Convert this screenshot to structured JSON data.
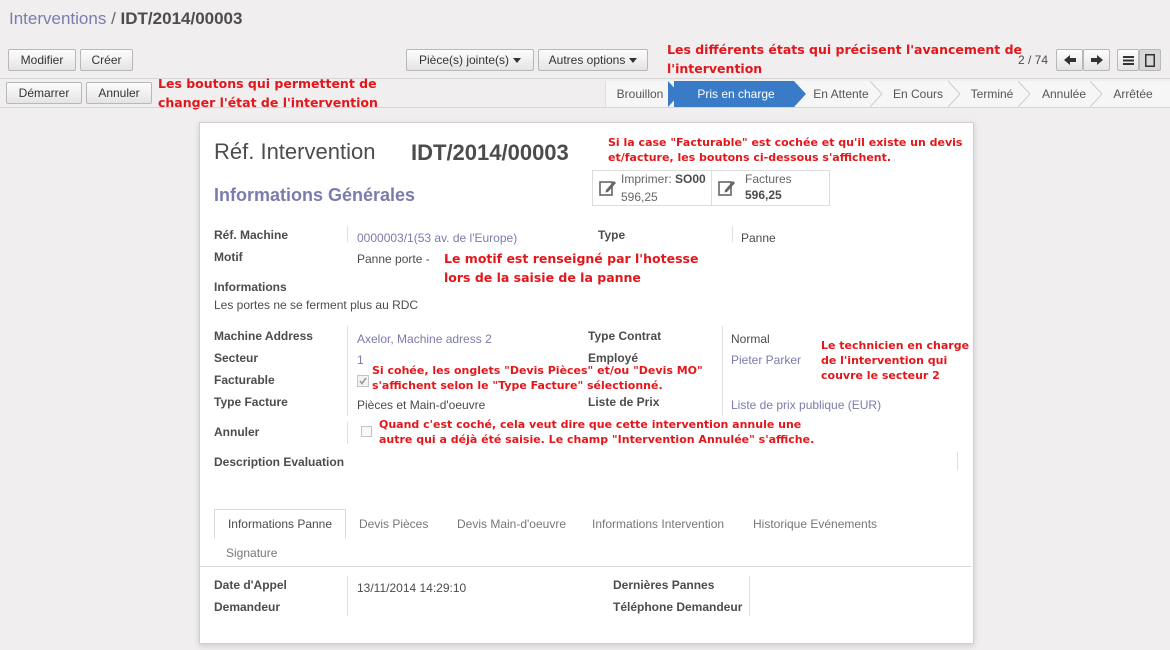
{
  "breadcrumb": {
    "parent": "Interventions",
    "separator": "/",
    "current": "IDT/2014/00003"
  },
  "toolbar": {
    "edit": "Modifier",
    "create": "Créer",
    "attachments": "Pièce(s) jointe(s)",
    "more": "Autres options",
    "pager": "2 / 74"
  },
  "actions": {
    "start": "Démarrer",
    "cancel": "Annuler"
  },
  "stages": [
    "Brouillon",
    "Pris en charge",
    "En Attente",
    "En Cours",
    "Terminé",
    "Annulée",
    "Arrêtée"
  ],
  "active_stage": "Pris en charge",
  "annotations": {
    "states_1": "Les différents états qui précisent l'avancement de",
    "states_2": "l'intervention",
    "buttons_1": "Les boutons qui permettent de",
    "buttons_2": "changer l'état de l'intervention",
    "billable_1": "Si la case \"Facturable\" est cochée et qu'il existe un devis",
    "billable_2": "et/facture, les boutons ci-dessous s'affichent.",
    "motif_1": "Le motif est renseigné par l'hotesse",
    "motif_2": "lors de la saisie de la panne",
    "tech_1": "Le technicien en charge",
    "tech_2": "de l'intervention qui",
    "tech_3": "couvre le secteur 2",
    "tabs_1": "Si cohée, les onglets \"Devis Pièces\" et/ou \"Devis MO\"",
    "tabs_2": "s'affichent selon le \"Type Facture\" sélectionné.",
    "cancel_1": "Quand c'est coché, cela veut dire que cette intervention annule une",
    "cancel_2": "autre qui a déjà été saisie. Le champ \"Intervention Annulée\" s'affiche."
  },
  "form": {
    "title_label": "Réf. Intervention",
    "title_value": "IDT/2014/00003",
    "section": "Informations Générales",
    "smart_print_label": "Imprimer:",
    "smart_print_ref": "SO00",
    "smart_print_value": "596,25",
    "smart_invoice_label": "Factures",
    "smart_invoice_value": "596,25",
    "machine_ref_label": "Réf. Machine",
    "machine_ref_value": "0000003/1(53 av. de l'Europe)",
    "type_label": "Type",
    "type_value": "Panne",
    "motif_label": "Motif",
    "motif_value": "Panne porte -",
    "info_label": "Informations",
    "info_value": "Les portes ne se ferment plus au RDC",
    "address_label": "Machine Address",
    "address_value": "Axelor, Machine adress 2",
    "contract_label": "Type Contrat",
    "contract_value": "Normal",
    "sector_label": "Secteur",
    "sector_value": "1",
    "employee_label": "Employé",
    "employee_value": "Pieter Parker",
    "billable_label": "Facturable",
    "billing_type_label": "Type Facture",
    "billing_type_value": "Pièces et Main-d'oeuvre",
    "pricelist_label": "Liste de Prix",
    "pricelist_value": "Liste de prix publique (EUR)",
    "cancel_label": "Annuler",
    "eval_label": "Description Evaluation"
  },
  "tabs": [
    "Informations Panne",
    "Devis Pièces",
    "Devis Main-d'oeuvre",
    "Informations Intervention",
    "Historique Evénements",
    "Signature"
  ],
  "tab_panel": {
    "call_date_label": "Date d'Appel",
    "call_date_value": "13/11/2014 14:29:10",
    "requester_label": "Demandeur",
    "last_failures_label": "Dernières Pannes",
    "requester_phone_label": "Téléphone Demandeur"
  },
  "colors": {
    "accent": "#7c7bad",
    "annotation": "#e3171b",
    "active_stage": "#3a7bc8"
  }
}
